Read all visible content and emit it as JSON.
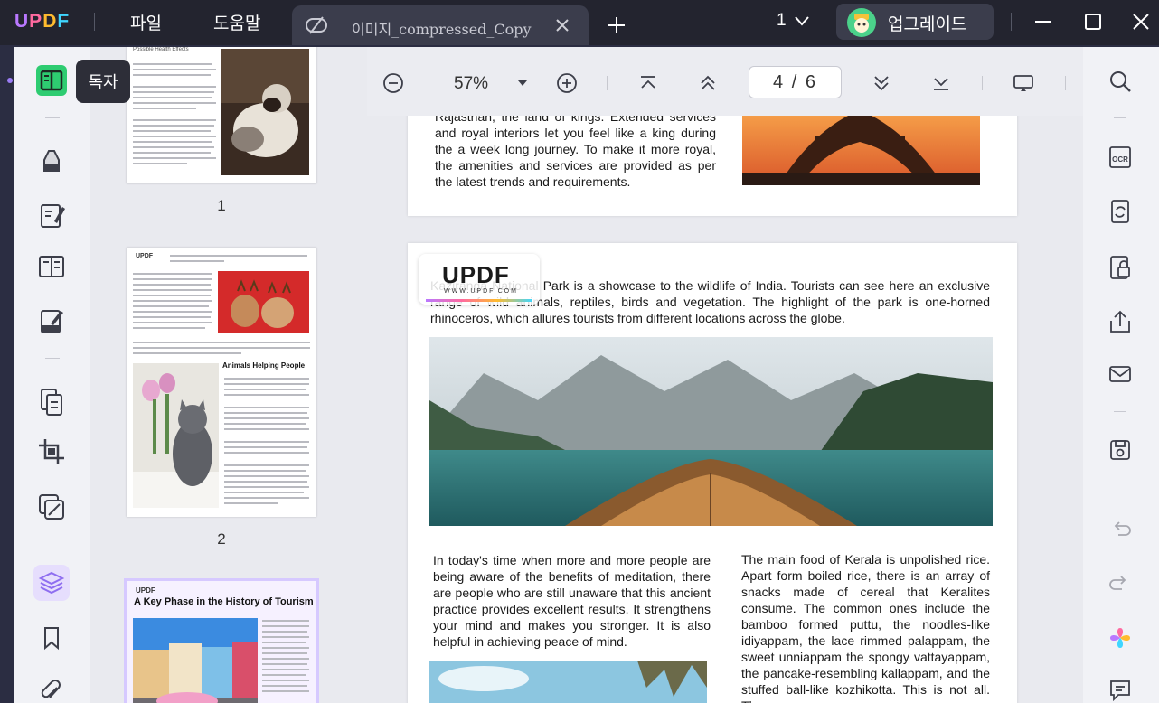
{
  "app": {
    "logo_text": "UPDF",
    "menu": {
      "file": "파일",
      "help": "도움말"
    },
    "tab": {
      "title": "이미지_compressed_Copy"
    },
    "page_counter": "1",
    "upgrade_label": "업그레이드"
  },
  "left_toolbar": {
    "tooltip": "독자",
    "items": [
      "reader-icon",
      "comment-icon",
      "edit-icon",
      "organize-icon",
      "fill-sign-icon",
      "convert-icon",
      "crop-icon",
      "protect-icon",
      "layers-icon",
      "bookmark-icon",
      "attachment-icon"
    ]
  },
  "thumbnails": {
    "pages": [
      {
        "number": "1",
        "header": "Possible Health Effects"
      },
      {
        "number": "2",
        "heading": "Animals Helping People"
      },
      {
        "heading": "A Key Phase in the History of Tourism",
        "logo": "UPDF"
      }
    ]
  },
  "viewer": {
    "zoom": "57%",
    "page_input": "4 / 6",
    "page1_text": "Rajasthan, the land of kings. Extended services and royal interiors let you feel like a king during the a week long journey. To make it more royal, the amenities and services are provided as per the latest trends and requirements.",
    "watermark": {
      "logo": "UPDF",
      "url": "WWW.UPDF.COM"
    },
    "page2_intro": "Kaziranga National Park is a showcase to the wildlife of India. Tourists can see here an exclusive range of wild animals, reptiles, birds and vegetation. The highlight of the park is one-horned rhinoceros, which allures tourists from different locations across the globe.",
    "page2_left": "In today's time when more and more people are being aware of the benefits of meditation, there are people who are still unaware that this ancient practice provides excellent results. It strengthens your mind and makes you stronger. It is also helpful in achieving peace of mind.",
    "page2_right": "The main food of Kerala is unpolished rice. Apart form boiled rice, there is an array of snacks made of cereal that Keralites consume. The common ones include the bamboo formed puttu, the noodles-like idiyappam, the lace rimmed palappam, the sweet unniappam the spongy vattayappam, the pancake-resembling kallappam, and the stuffed ball-like kozhikotta. This is not all. The"
  },
  "right_toolbar": {
    "items": [
      "search-icon",
      "ocr-icon",
      "convert-icon",
      "protect-icon",
      "share-icon",
      "email-icon",
      "save-icon",
      "undo-icon",
      "redo-icon",
      "ai-icon",
      "comment-icon"
    ]
  },
  "colors": {
    "titlebar": "#23242f",
    "tab": "#3b3d4c",
    "accent": "#9b7cf5",
    "reader_active": "#2ecc71"
  }
}
